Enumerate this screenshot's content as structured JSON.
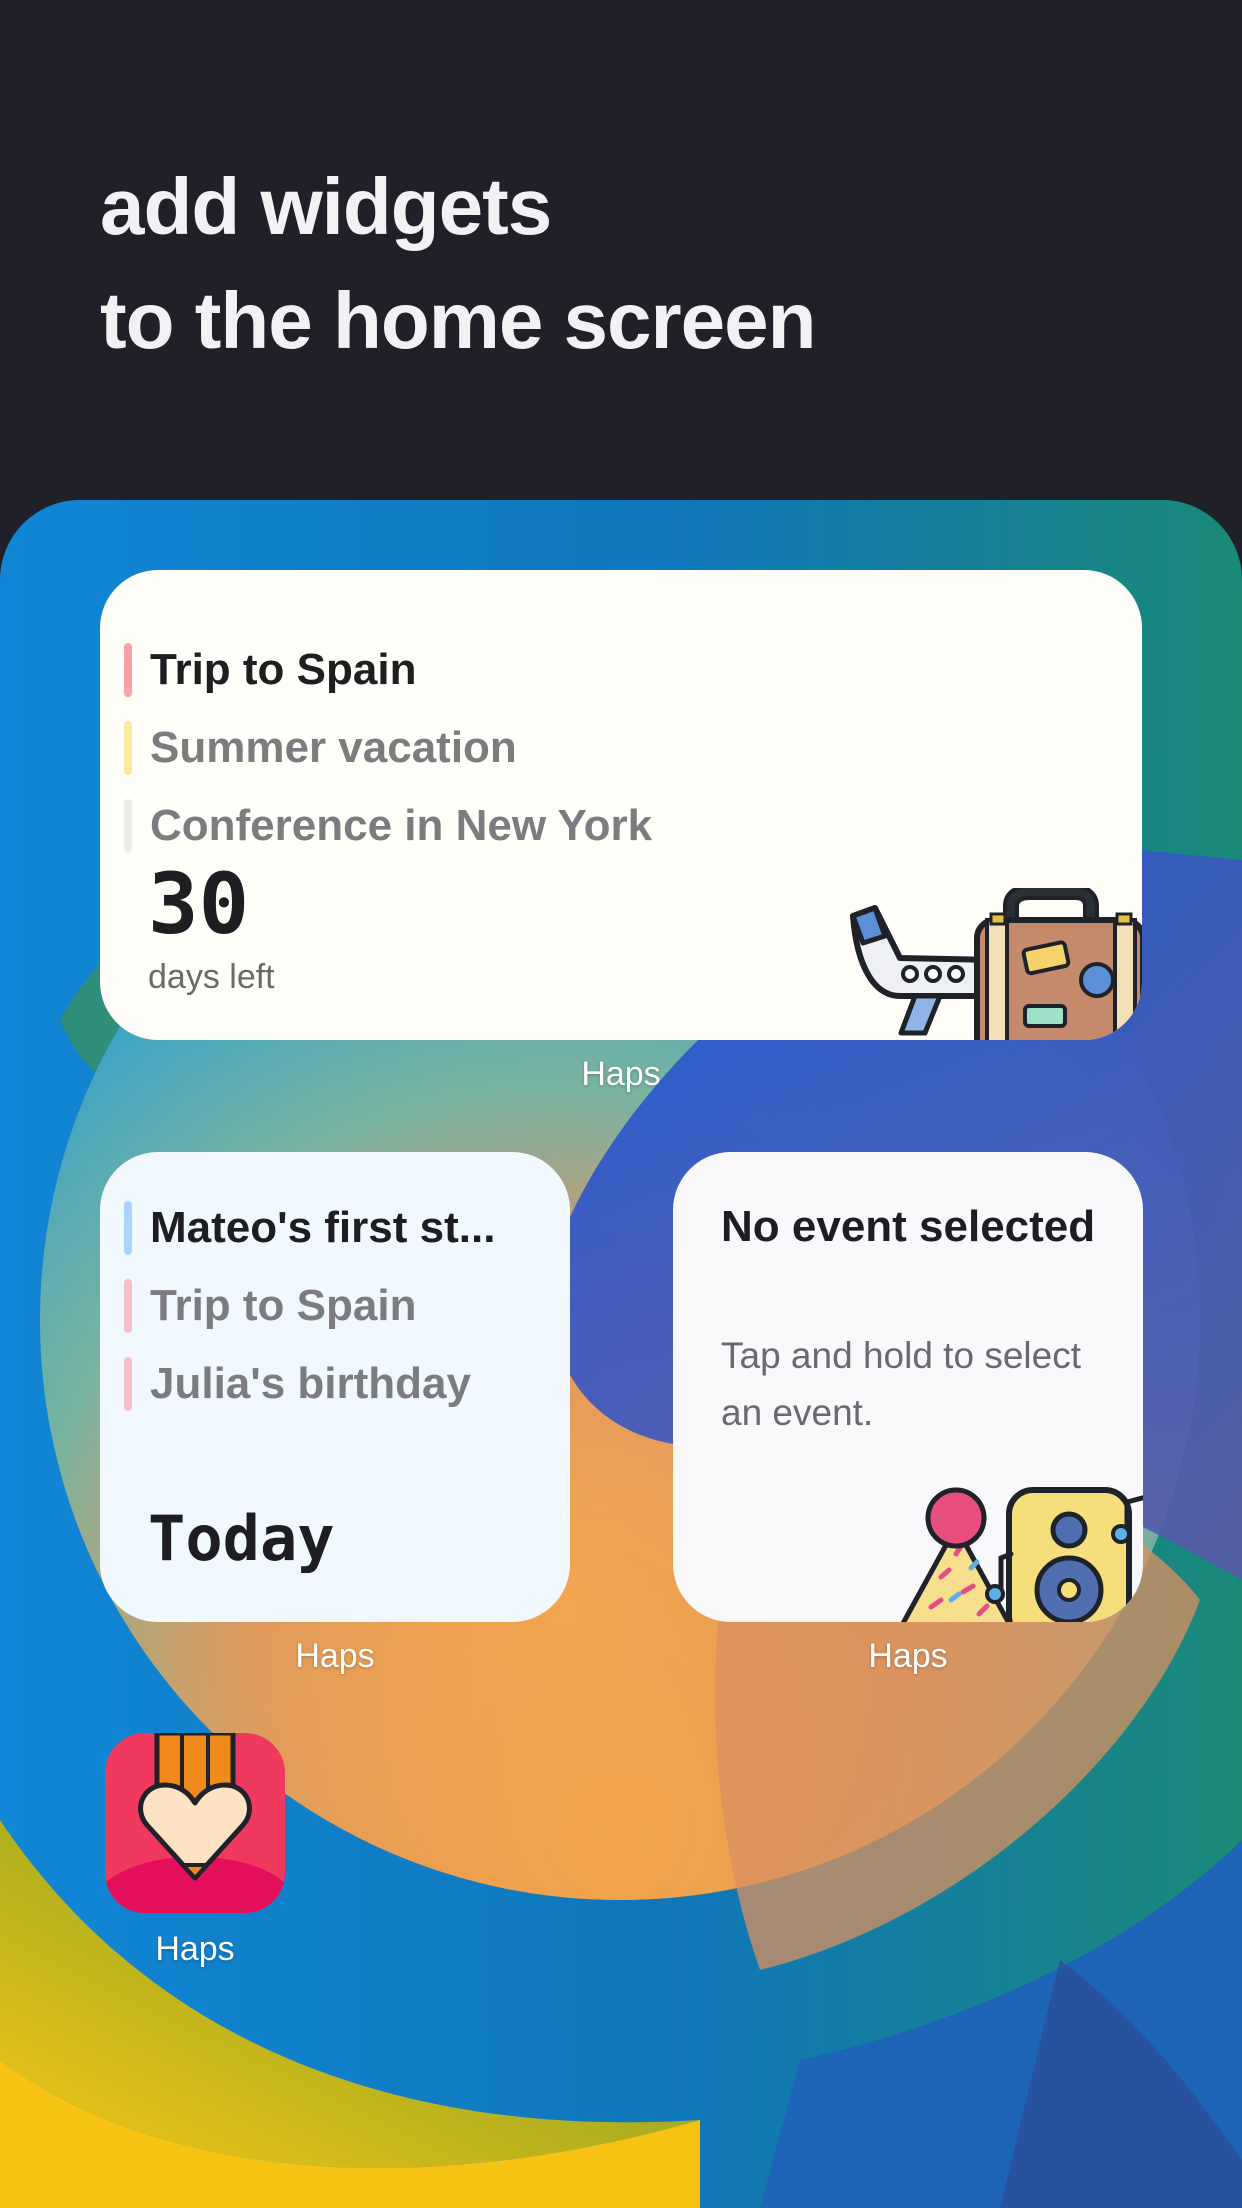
{
  "headline": {
    "line1": "add widgets",
    "line2": "to the home screen"
  },
  "large_widget": {
    "events": [
      {
        "title": "Trip to Spain",
        "color": "#f7a3a8",
        "style": "primary"
      },
      {
        "title": "Summer vacation",
        "color": "#f8ec9c",
        "style": "secondary"
      },
      {
        "title": "Conference in New York",
        "color": "#ececec",
        "style": "secondary"
      }
    ],
    "days_number": "30",
    "days_label": "days left",
    "illustration": "airplane-suitcase-icon",
    "app_label": "Haps"
  },
  "small_widget_left": {
    "events": [
      {
        "title": "Mateo's first st...",
        "color": "#a8d4ff",
        "style": "primary"
      },
      {
        "title": "Trip to Spain",
        "color": "#f7c0c4",
        "style": "secondary"
      },
      {
        "title": "Julia's birthday",
        "color": "#f7c0c4",
        "style": "secondary"
      }
    ],
    "countdown": "Today",
    "app_label": "Haps"
  },
  "small_widget_right": {
    "title": "No event selected",
    "description": "Tap and hold to select an event.",
    "illustration": "party-speaker-icon",
    "app_label": "Haps"
  },
  "app_icon": {
    "name": "haps-app-icon",
    "label": "Haps",
    "colors": {
      "background": "#f0395f",
      "pencil": "#f08a1c",
      "heart": "#fde3c4"
    }
  }
}
